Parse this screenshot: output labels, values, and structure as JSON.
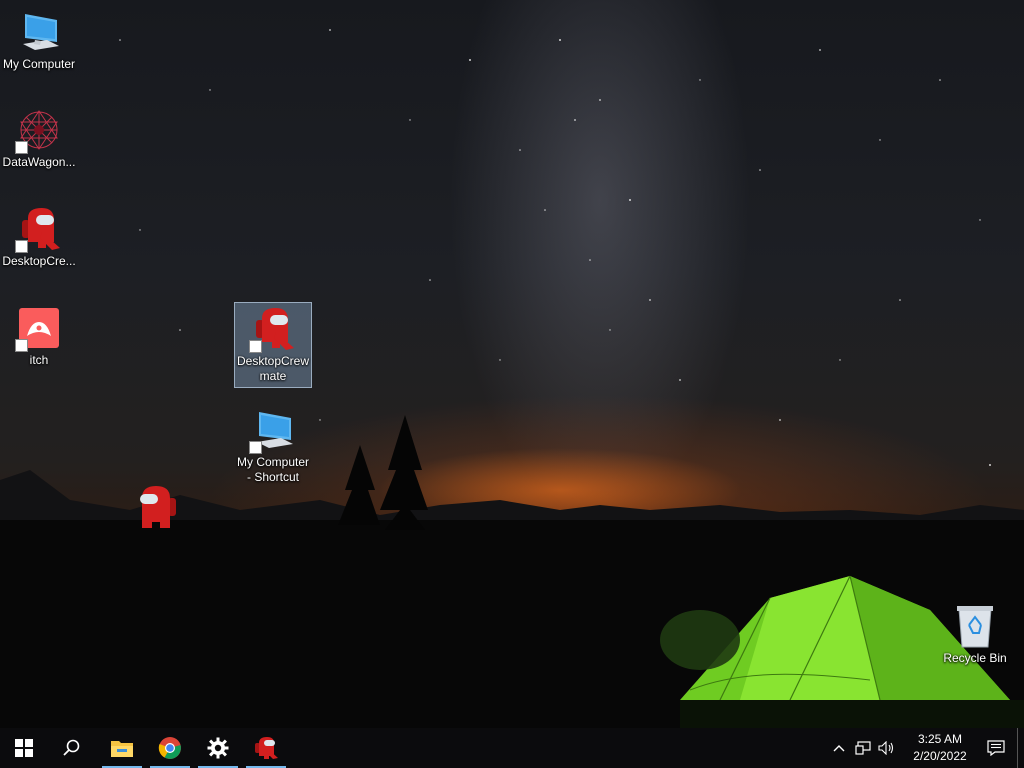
{
  "desktop": {
    "icons": [
      {
        "label": "My Computer",
        "icon": "computer-icon",
        "shortcut": false
      },
      {
        "label": "DataWagon...",
        "icon": "datawagon-icon",
        "shortcut": true
      },
      {
        "label": "DesktopCre...",
        "icon": "crewmate-icon",
        "shortcut": true
      },
      {
        "label": "itch",
        "icon": "itch-icon",
        "shortcut": true
      },
      {
        "label": "DesktopCrew mate",
        "icon": "crewmate-icon",
        "shortcut": true,
        "selected": true
      },
      {
        "label": "My Computer - Shortcut",
        "icon": "computer-icon",
        "shortcut": true
      },
      {
        "label": "Recycle Bin",
        "icon": "recycle-bin-icon",
        "shortcut": false
      }
    ],
    "pet": {
      "name": "crewmate-pet",
      "color": "#d21f1f"
    }
  },
  "taskbar": {
    "start": "windows-start-icon",
    "search": "search-icon",
    "pinned": [
      "file-explorer-icon",
      "chrome-icon",
      "settings-icon",
      "crewmate-app-icon"
    ],
    "tray": {
      "chevron": "^",
      "time": "3:25 AM",
      "date": "2/20/2022"
    }
  },
  "colors": {
    "accent": "#76b9ed",
    "crewmate_red": "#d21f1f",
    "taskbar_bg": "#0b0b0d",
    "tent_green": "#7fdc2a"
  }
}
